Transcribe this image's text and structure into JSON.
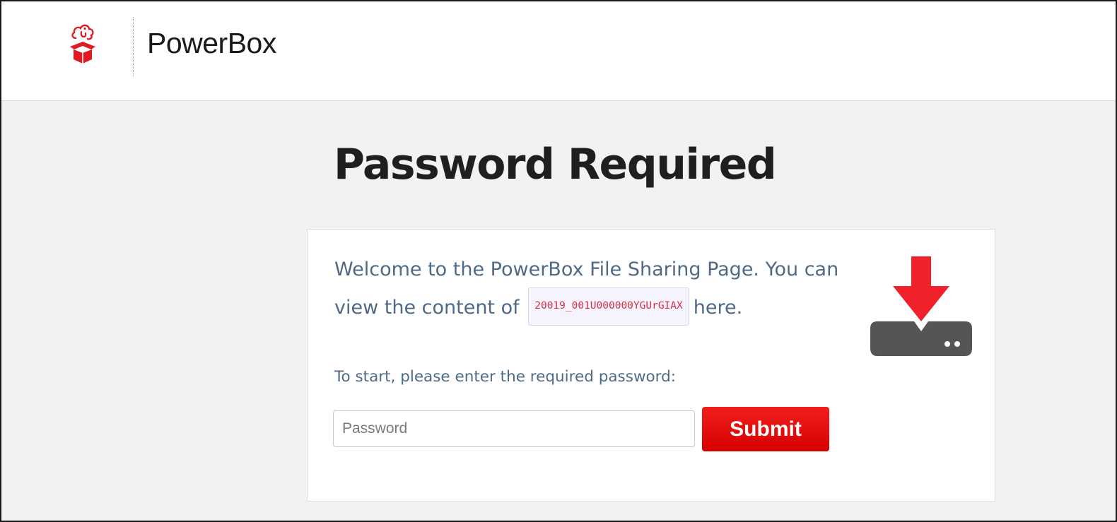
{
  "header": {
    "brand_name": "PowerBox",
    "logo_icon": "cloud-box-icon"
  },
  "main": {
    "title": "Password Required",
    "card": {
      "welcome_prefix": "Welcome to the PowerBox File Sharing Page. You can view the content of",
      "shared_item_code": "20019_001U000000YGUrGIAX",
      "welcome_suffix": "here.",
      "prompt": "To start, please enter the required password:",
      "password_placeholder": "Password",
      "password_value": "",
      "submit_label": "Submit",
      "download_icon": "download-icon"
    }
  },
  "colors": {
    "brand_red": "#e01b24",
    "text_blue": "#4e6a86",
    "code_red": "#d63045",
    "icon_gray": "#555555",
    "background": "#f2f2f2"
  }
}
